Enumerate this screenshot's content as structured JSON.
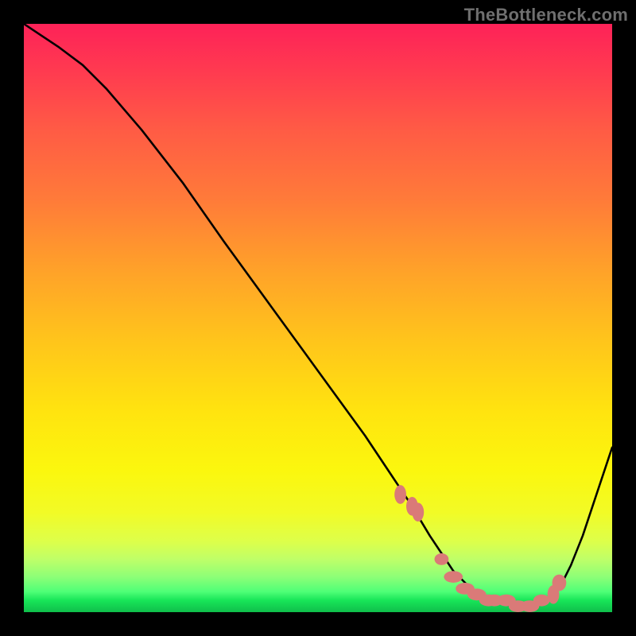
{
  "watermark": "TheBottleneck.com",
  "chart_data": {
    "type": "line",
    "title": "",
    "xlabel": "",
    "ylabel": "",
    "xlim": [
      0,
      100
    ],
    "ylim": [
      0,
      100
    ],
    "grid": false,
    "legend_pos": "none",
    "series": [
      {
        "name": "bottleneck-curve",
        "x": [
          0,
          3,
          6,
          10,
          14,
          20,
          27,
          34,
          42,
          50,
          58,
          62,
          66,
          69,
          71,
          73,
          75,
          77,
          80,
          83,
          86,
          89,
          91,
          93,
          95,
          97,
          100
        ],
        "values": [
          100,
          98,
          96,
          93,
          89,
          82,
          73,
          63,
          52,
          41,
          30,
          24,
          18,
          13,
          10,
          7,
          5,
          3,
          2,
          1,
          1,
          2,
          4,
          8,
          13,
          19,
          28
        ]
      }
    ],
    "markers": {
      "name": "highlighted-points",
      "x": [
        64,
        66,
        67,
        71,
        73,
        75,
        77,
        79,
        80,
        82,
        84,
        86,
        88,
        90,
        91
      ],
      "values": [
        20,
        18,
        17,
        9,
        6,
        4,
        3,
        2,
        2,
        2,
        1,
        1,
        2,
        3,
        5
      ],
      "rx": [
        1.0,
        1.0,
        1.0,
        1.2,
        1.6,
        1.6,
        1.6,
        1.6,
        1.4,
        1.6,
        1.6,
        1.6,
        1.4,
        1.0,
        1.2
      ],
      "ry": [
        1.6,
        1.6,
        1.6,
        1.0,
        1.0,
        1.0,
        1.0,
        1.0,
        1.0,
        1.0,
        1.0,
        1.0,
        1.0,
        1.6,
        1.4
      ]
    },
    "colors": {
      "curve": "#000000",
      "marker": "#da7a78"
    }
  }
}
